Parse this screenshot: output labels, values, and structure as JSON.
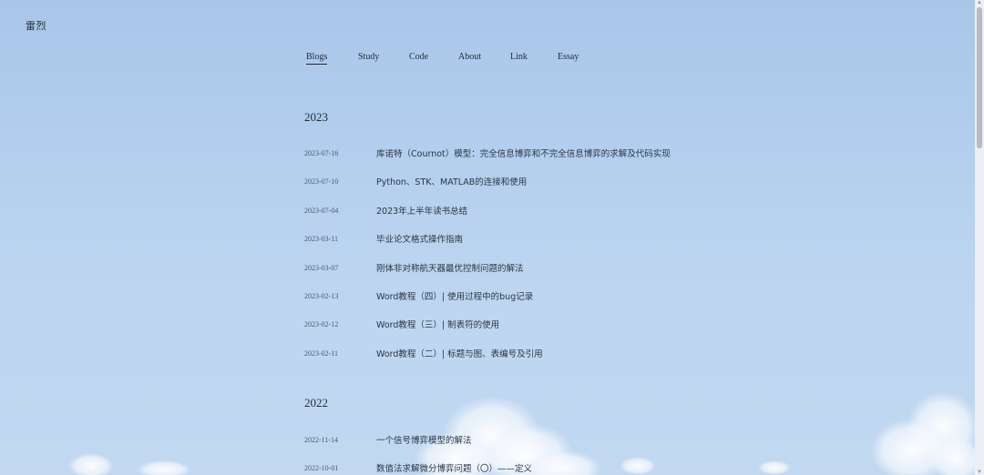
{
  "site": {
    "title": "雷烈"
  },
  "nav": {
    "items": [
      {
        "label": "Blogs"
      },
      {
        "label": "Study"
      },
      {
        "label": "Code"
      },
      {
        "label": "About"
      },
      {
        "label": "Link"
      },
      {
        "label": "Essay"
      }
    ]
  },
  "sections": [
    {
      "year": "2023",
      "posts": [
        {
          "date": "2023-07-16",
          "title": "库诺特（Cournot）模型：完全信息博弈和不完全信息博弈的求解及代码实现"
        },
        {
          "date": "2023-07-10",
          "title": "Python、STK、MATLAB的连接和使用"
        },
        {
          "date": "2023-07-04",
          "title": "2023年上半年读书总结"
        },
        {
          "date": "2023-03-11",
          "title": "毕业论文格式操作指南"
        },
        {
          "date": "2023-03-07",
          "title": "刚体非对称航天器最优控制问题的解法"
        },
        {
          "date": "2023-02-13",
          "title": "Word教程（四）| 使用过程中的bug记录"
        },
        {
          "date": "2023-02-12",
          "title": "Word教程（三）| 制表符的使用"
        },
        {
          "date": "2023-02-11",
          "title": "Word教程（二）| 标题与图、表编号及引用"
        }
      ]
    },
    {
      "year": "2022",
      "posts": [
        {
          "date": "2022-11-14",
          "title": "一个信号博弈模型的解法"
        },
        {
          "date": "2022-10-01",
          "title": "数值法求解微分博弈问题（〇）——定义"
        }
      ]
    }
  ]
}
